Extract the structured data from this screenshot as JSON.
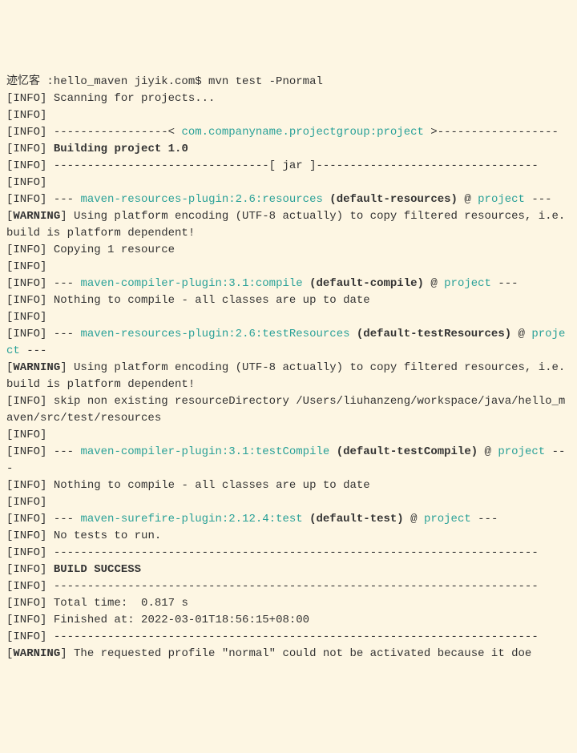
{
  "prompt": {
    "prefix": "迹忆客 :hello_maven jiyik.com$ ",
    "command": "mvn test -Pnormal"
  },
  "info": "[INFO]",
  "warning": "[WARNING]",
  "lines": {
    "l1": " Scanning for projects...",
    "l2": " ",
    "l3a": " -----------------< ",
    "l3b": "com.companyname.projectgroup:project",
    "l3c": " >------------------",
    "l4": "Building project 1.0",
    "l5a": " --------------------------------[ ",
    "l5b": "jar",
    "l5c": " ]---------------------------------",
    "l6": " ",
    "l7a": " --- ",
    "l7b": "maven-resources-plugin:2.6:resources",
    "l7c": " (default-resources)",
    "l7d": " @ ",
    "l7e": "project",
    "l7f": " ---",
    "l8": " Using platform encoding (UTF-8 actually) to copy filtered resources, i.e. build is platform dependent!",
    "l9": " Copying 1 resource",
    "l10": " ",
    "l11a": " --- ",
    "l11b": "maven-compiler-plugin:3.1:compile",
    "l11c": " (default-compile)",
    "l11d": " @ ",
    "l11e": "project",
    "l11f": " ---",
    "l12": " Nothing to compile - all classes are up to date",
    "l13": " ",
    "l14a": " --- ",
    "l14b": "maven-resources-plugin:2.6:testResources",
    "l14c": " (default-testResources)",
    "l14d": " @ ",
    "l14e": "project",
    "l14f": " ---",
    "l15": " Using platform encoding (UTF-8 actually) to copy filtered resources, i.e. build is platform dependent!",
    "l16": " skip non existing resourceDirectory /Users/liuhanzeng/workspace/java/hello_maven/src/test/resources",
    "l17": " ",
    "l18a": " --- ",
    "l18b": "maven-compiler-plugin:3.1:testCompile",
    "l18c": " (default-testCompile)",
    "l18d": " @ ",
    "l18e": "project",
    "l18f": " ---",
    "l19": " Nothing to compile - all classes are up to date",
    "l20": " ",
    "l21a": " --- ",
    "l21b": "maven-surefire-plugin:2.12.4:test",
    "l21c": " (default-test)",
    "l21d": " @ ",
    "l21e": "project",
    "l21f": " ---",
    "l22": " No tests to run.",
    "l23": " ------------------------------------------------------------------------",
    "l24": "BUILD SUCCESS",
    "l25": " ------------------------------------------------------------------------",
    "l26": " Total time:  0.817 s",
    "l27": " Finished at: 2022-03-01T18:56:15+08:00",
    "l28": " ------------------------------------------------------------------------",
    "l29": " The requested profile \"normal\" could not be activated because it doe"
  }
}
